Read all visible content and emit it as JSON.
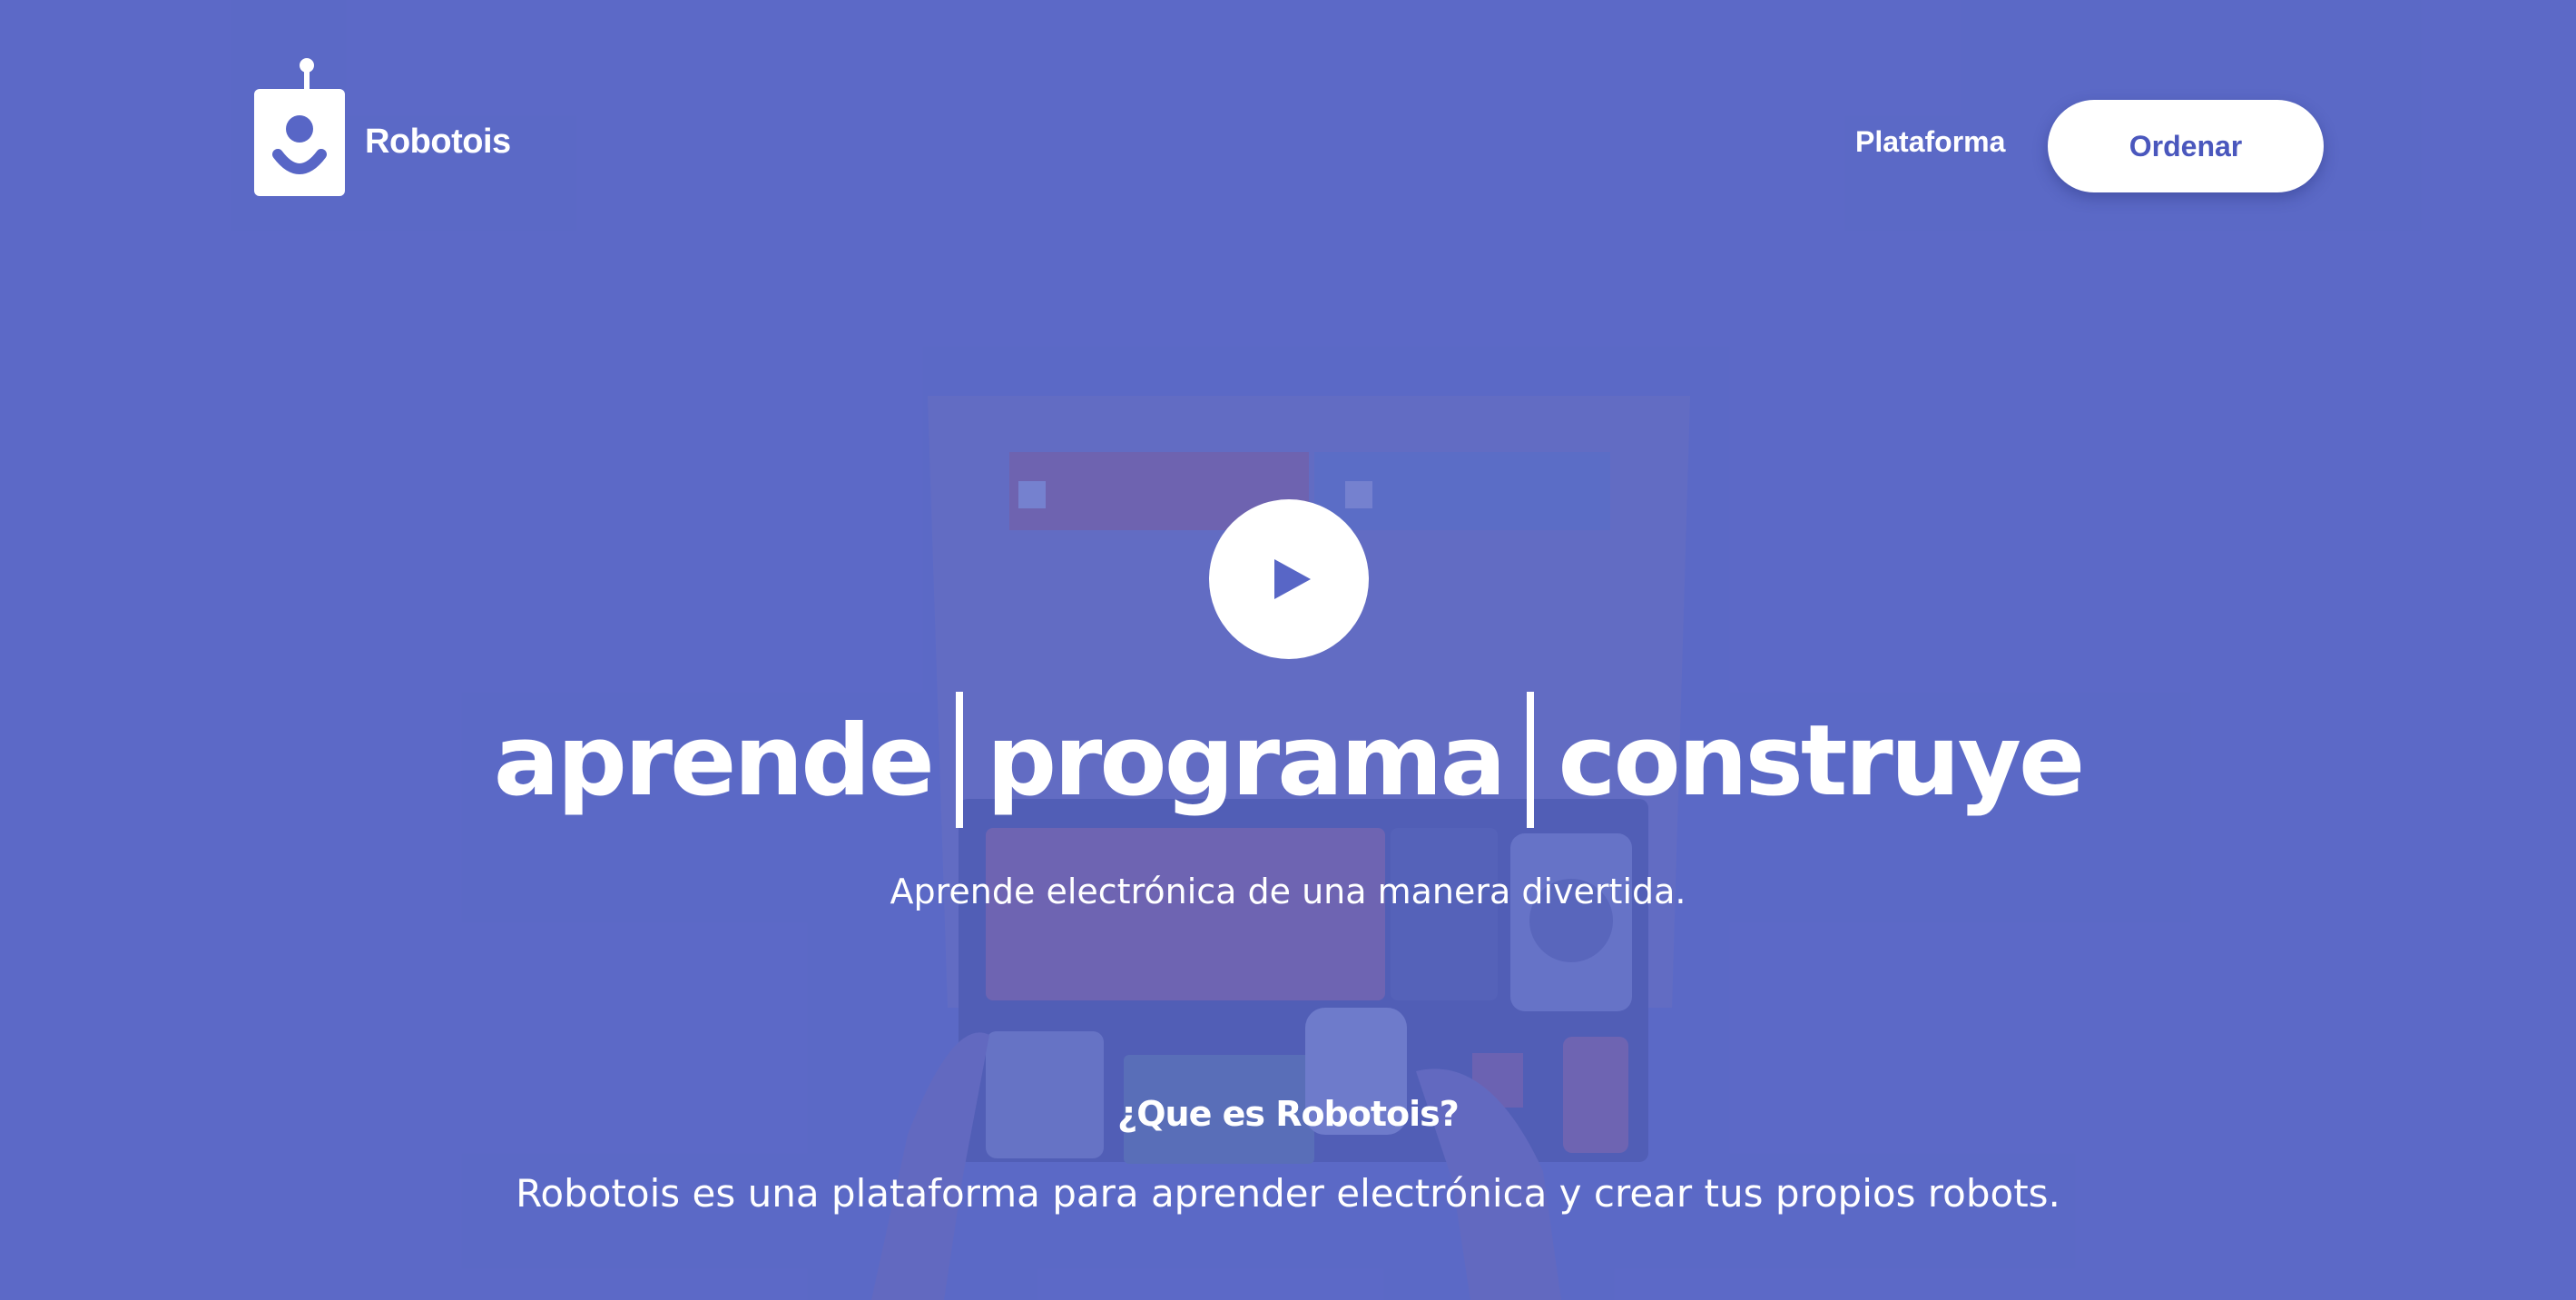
{
  "brand": {
    "name": "Robotois"
  },
  "nav": {
    "platform_link": "Plataforma",
    "order_button": "Ordenar"
  },
  "hero": {
    "words": [
      "aprende",
      "programa",
      "construye"
    ],
    "tagline": "Aprende electrónica de una manera divertida.",
    "video_button": "play-icon"
  },
  "about": {
    "title": "¿Que es Robotois?",
    "description": "Robotois es una plataforma para aprender electrónica y crear tus propios robots."
  },
  "colors": {
    "background": "#5866c6",
    "accent": "#4a57bd",
    "text": "#ffffff"
  }
}
